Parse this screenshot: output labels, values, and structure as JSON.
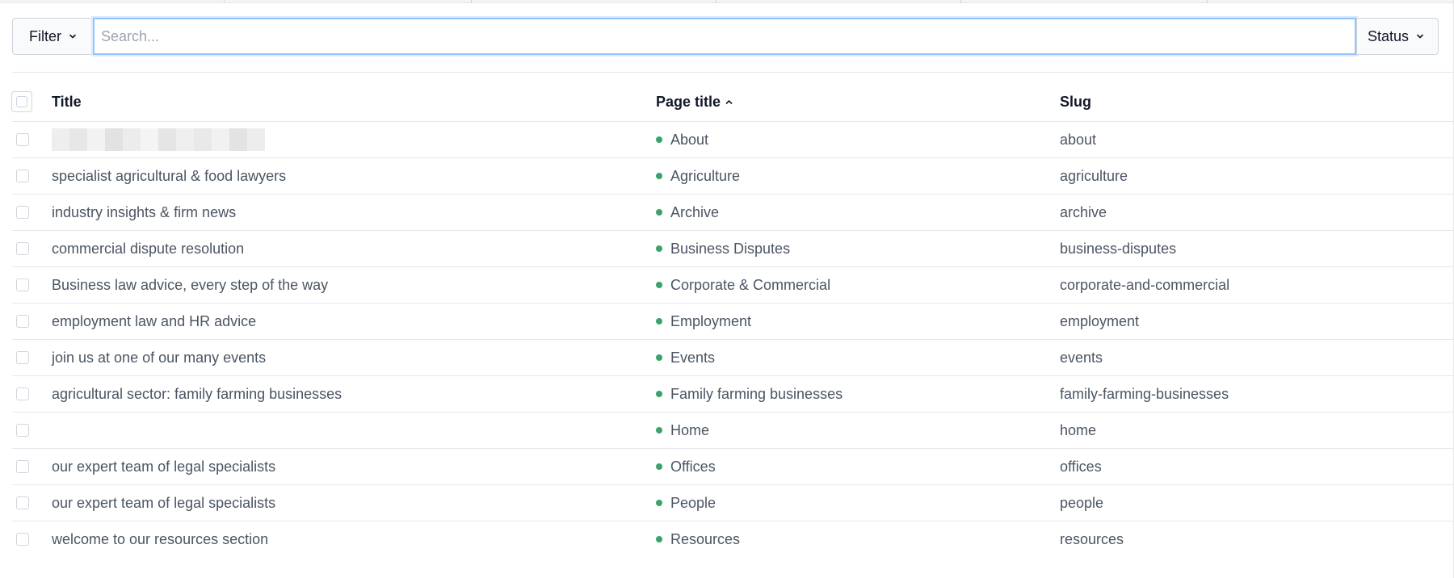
{
  "toolbar": {
    "filter_label": "Filter",
    "search_placeholder": "Search...",
    "search_value": "",
    "status_label": "Status"
  },
  "table": {
    "columns": {
      "title": "Title",
      "page_title": "Page title",
      "slug": "Slug"
    },
    "sort": {
      "column": "page_title",
      "direction": "ascending"
    },
    "status_color": "#3aa36b",
    "rows": [
      {
        "title": "",
        "title_redacted": true,
        "page_title": "About",
        "slug": "about"
      },
      {
        "title": "specialist agricultural & food lawyers",
        "page_title": "Agriculture",
        "slug": "agriculture"
      },
      {
        "title": "industry insights & firm news",
        "page_title": "Archive",
        "slug": "archive"
      },
      {
        "title": "commercial dispute resolution",
        "page_title": "Business Disputes",
        "slug": "business-disputes"
      },
      {
        "title": "Business law advice, every step of the way",
        "page_title": "Corporate & Commercial",
        "slug": "corporate-and-commercial"
      },
      {
        "title": "employment law and HR advice",
        "page_title": "Employment",
        "slug": "employment"
      },
      {
        "title": "join us at one of our many events",
        "page_title": "Events",
        "slug": "events"
      },
      {
        "title": "agricultural sector: family farming businesses",
        "page_title": "Family farming businesses",
        "slug": "family-farming-businesses"
      },
      {
        "title": "",
        "page_title": "Home",
        "slug": "home"
      },
      {
        "title": "our expert team of legal specialists",
        "page_title": "Offices",
        "slug": "offices"
      },
      {
        "title": "our expert team of legal specialists",
        "page_title": "People",
        "slug": "people"
      },
      {
        "title": "welcome to our resources section",
        "page_title": "Resources",
        "slug": "resources"
      }
    ]
  }
}
